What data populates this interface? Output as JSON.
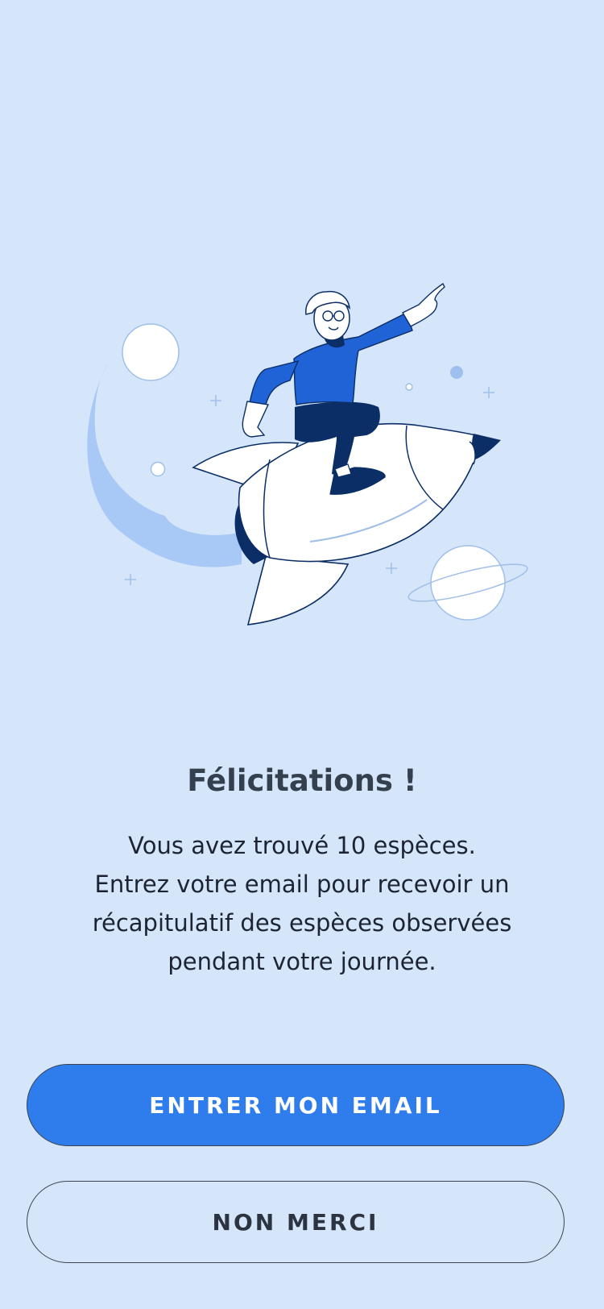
{
  "screen": {
    "title": "Félicitations !",
    "message_lines": [
      "Vous avez trouvé 10 espèces.",
      "Entrez votre email pour recevoir un",
      "récapitulatif des espèces observées",
      "pendant votre journée."
    ]
  },
  "actions": {
    "primary_label": "ENTRER MON EMAIL",
    "secondary_label": "NON MERCI"
  },
  "colors": {
    "background": "#d6e6fa",
    "primary_button": "#2f7ded",
    "illustration_blue": "#1f63d6",
    "illustration_navy": "#0b2e66"
  },
  "illustration": {
    "name": "person-riding-rocket-illustration"
  }
}
